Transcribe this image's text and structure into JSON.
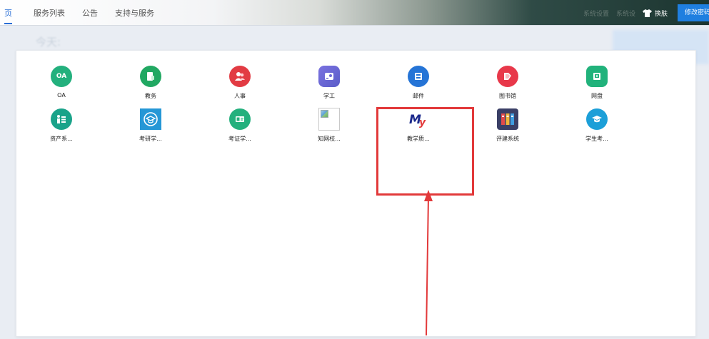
{
  "nav": {
    "active_partial": "页",
    "items": [
      "服务列表",
      "公告",
      "支持与服务"
    ]
  },
  "top_right": {
    "faint_links": [
      "系统设置",
      "系统设"
    ],
    "skin_label": "换肤",
    "change_password_label": "修改密码"
  },
  "background": {
    "today_label": "今天:"
  },
  "apps": [
    {
      "label": "OA",
      "icon": "oa-icon",
      "color": "#23b07d"
    },
    {
      "label": "教务",
      "icon": "academic-icon",
      "color": "#21a862"
    },
    {
      "label": "人事",
      "icon": "personnel-icon",
      "color": "#e23b43"
    },
    {
      "label": "学工",
      "icon": "student-affairs-icon",
      "color": "#6d68d6"
    },
    {
      "label": "邮件",
      "icon": "mail-icon",
      "color": "#2574d6"
    },
    {
      "label": "图书馆",
      "icon": "library-icon",
      "color": "#e8384a"
    },
    {
      "label": "网盘",
      "icon": "cloud-drive-icon",
      "color": "#21b27b"
    },
    {
      "label": "资产系...",
      "icon": "assets-icon",
      "color": "#1aa38a"
    },
    {
      "label": "考研学...",
      "icon": "graduate-exam-icon",
      "color": "#2597d6"
    },
    {
      "label": "考证学...",
      "icon": "certificate-icon",
      "color": "#23b07d"
    },
    {
      "label": "知网校...",
      "icon": "broken-image-icon",
      "color": "#cccccc"
    },
    {
      "label": "教学质...",
      "icon": "my-logo-icon",
      "color": "#1c2a8c"
    },
    {
      "label": "评建系统",
      "icon": "evaluation-books-icon",
      "color": "#3a3f66"
    },
    {
      "label": "学生考...",
      "icon": "student-exam-icon",
      "color": "#1c9fd8"
    }
  ],
  "my_logo_text": {
    "m": "M",
    "y": "y"
  }
}
